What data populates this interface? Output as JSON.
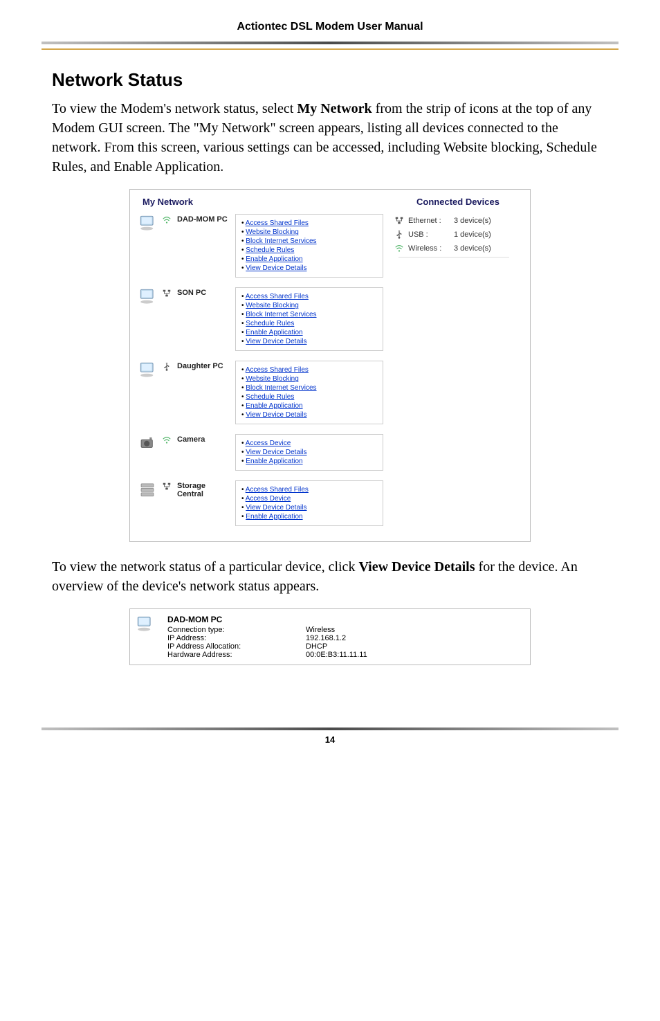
{
  "header_title": "Actiontec DSL Modem User Manual",
  "section_title": "Network Status",
  "intro_parts": {
    "p1_before": "To view the Modem's network status, select ",
    "p1_bold": "My Network",
    "p1_after": " from the strip of icons at the top of any Modem GUI screen. The \"My Network\" screen appears, listing all devices connected to the network. From this screen, various settings can be accessed, including Website blocking, Schedule Rules, and Enable Application."
  },
  "panel": {
    "title": "My Network",
    "devices": [
      {
        "name": "DAD-MOM PC",
        "conn_type": "wireless",
        "icon": "pc",
        "actions": [
          "Access Shared Files",
          "Website Blocking",
          "Block Internet Services",
          "Schedule Rules",
          "Enable Application",
          "View Device Details"
        ]
      },
      {
        "name": "SON PC",
        "conn_type": "ethernet",
        "icon": "pc",
        "actions": [
          "Access Shared Files",
          "Website Blocking",
          "Block Internet Services",
          "Schedule Rules",
          "Enable Application",
          "View Device Details"
        ]
      },
      {
        "name": "Daughter PC",
        "conn_type": "usb",
        "icon": "pc",
        "actions": [
          "Access Shared Files",
          "Website Blocking",
          "Block Internet Services",
          "Schedule Rules",
          "Enable Application",
          "View Device Details"
        ]
      },
      {
        "name": "Camera",
        "conn_type": "wireless",
        "icon": "camera",
        "actions": [
          "Access Device",
          "View Device Details",
          "Enable Application"
        ]
      },
      {
        "name": "Storage Central",
        "conn_type": "ethernet",
        "icon": "storage",
        "actions": [
          "Access Shared Files",
          "Access Device",
          "View Device Details",
          "Enable Application"
        ]
      }
    ],
    "connected_title": "Connected Devices",
    "connected": [
      {
        "icon": "ethernet",
        "label": "Ethernet :",
        "count": "3 device(s)"
      },
      {
        "icon": "usb",
        "label": "USB :",
        "count": "1 device(s)"
      },
      {
        "icon": "wireless",
        "label": "Wireless :",
        "count": "3 device(s)"
      }
    ]
  },
  "outro_parts": {
    "p2_before": "To view the network status of a particular device, click ",
    "p2_bold": "View Device Details",
    "p2_after": " for the device. An overview of the device's network status appears."
  },
  "details": {
    "device_name": "DAD-MOM PC",
    "rows": [
      {
        "label": "Connection type:",
        "value": "Wireless"
      },
      {
        "label": "IP Address:",
        "value": "192.168.1.2"
      },
      {
        "label": "IP Address Allocation:",
        "value": "DHCP"
      },
      {
        "label": "Hardware Address:",
        "value": "00:0E:B3:11.11.11"
      }
    ]
  },
  "page_number": "14"
}
